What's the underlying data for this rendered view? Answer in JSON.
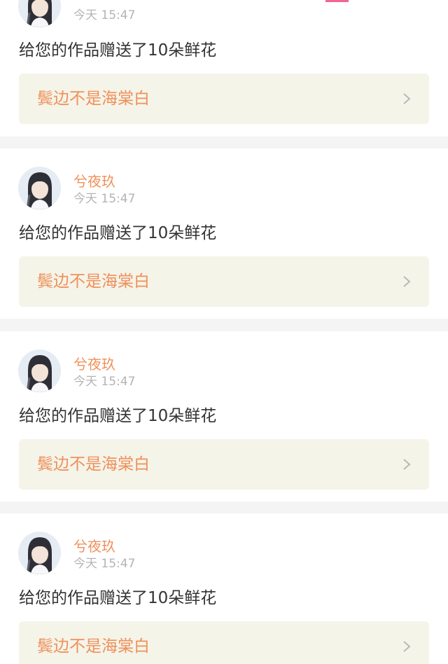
{
  "notifications": [
    {
      "username": "",
      "time": "今天 15:47",
      "message": "给您的作品赠送了10朵鲜花",
      "work_title": "鬓边不是海棠白"
    },
    {
      "username": "兮夜玖",
      "time": "今天 15:47",
      "message": "给您的作品赠送了10朵鲜花",
      "work_title": "鬓边不是海棠白"
    },
    {
      "username": "兮夜玖",
      "time": "今天 15:47",
      "message": "给您的作品赠送了10朵鲜花",
      "work_title": "鬓边不是海棠白"
    },
    {
      "username": "兮夜玖",
      "time": "今天 15:47",
      "message": "给您的作品赠送了10朵鲜花",
      "work_title": "鬓边不是海棠白"
    }
  ],
  "colors": {
    "accent": "#f0905a",
    "link_background": "#f4f4e9",
    "time_text": "#b4b4b4",
    "body_text": "#333333",
    "page_background": "#f4f4f4",
    "badge": "#f06496"
  },
  "icons": {
    "avatar": "girl-avatar-icon",
    "chevron": "chevron-right-icon"
  }
}
